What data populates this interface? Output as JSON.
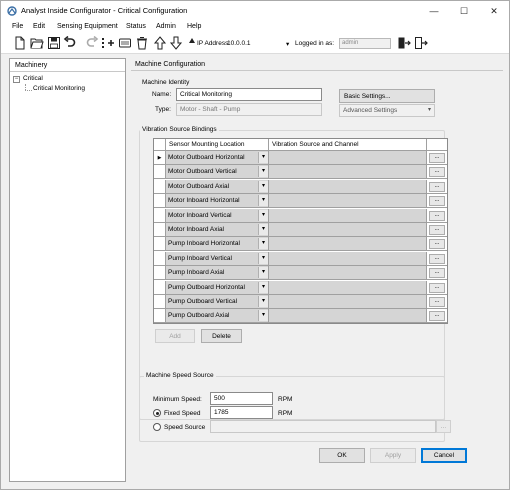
{
  "window": {
    "title": "Analyst Inside Configurator - Critical Configuration",
    "minimize": "—",
    "maximize": "☐",
    "close": "✕"
  },
  "menu": [
    "File",
    "Edit",
    "Sensing Equipment",
    "Status",
    "Admin",
    "Help"
  ],
  "toolbar": {
    "ip_label": "IP Address:",
    "ip_value": "10.0.0.1",
    "logged_label": "Logged in as:",
    "user": "admin"
  },
  "left_panel": {
    "header": "Machinery",
    "tree_root": "Critical",
    "tree_child": "Critical Monitoring",
    "expander": "−"
  },
  "config": {
    "header": "Machine Configuration",
    "identity": {
      "title": "Machine Identity",
      "name_label": "Name:",
      "name_value": "Critical Monitoring",
      "type_label": "Type:",
      "type_value": "Motor - Shaft - Pump",
      "basic_settings": "Basic Settings...",
      "advanced_settings": "Advanced Settings"
    },
    "bindings": {
      "title": "Vibration Source Bindings",
      "col_location": "Sensor Mounting Location",
      "col_source": "Vibration Source and Channel",
      "rows": [
        "Motor Outboard Horizontal",
        "Motor Outboard Vertical",
        "Motor Outboard Axial",
        "Motor Inboard Horizontal",
        "Motor Inboard Vertical",
        "Motor Inboard Axial",
        "Pump Inboard Horizontal",
        "Pump Inboard Vertical",
        "Pump Inboard Axial",
        "Pump Outboard Horizontal",
        "Pump Outboard Vertical",
        "Pump Outboard Axial"
      ],
      "ellipsis": "...",
      "current_marker": "▶",
      "add": "Add",
      "delete": "Delete"
    },
    "speed": {
      "title": "Machine Speed Source",
      "min_label": "Minimum Speed:",
      "min_value": "500",
      "min_unit": "RPM",
      "fixed_label": "Fixed Speed",
      "fixed_value": "1785",
      "fixed_unit": "RPM",
      "source_label": "Speed Source",
      "source_btn": "..."
    },
    "buttons": {
      "ok": "OK",
      "apply": "Apply",
      "cancel": "Cancel"
    }
  }
}
